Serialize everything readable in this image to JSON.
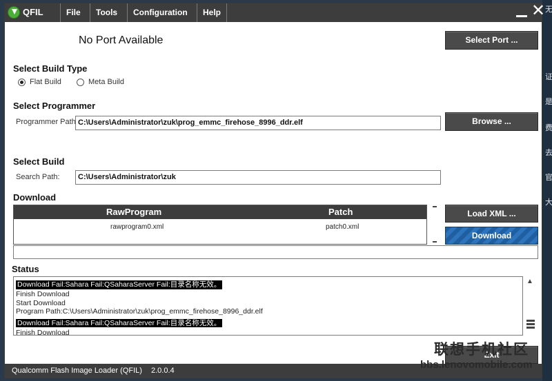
{
  "window": {
    "app_title": "QFIL",
    "menu": [
      "File",
      "Tools",
      "Configuration",
      "Help"
    ]
  },
  "port": {
    "status": "No Port Available",
    "select_button": "Select Port ..."
  },
  "build_type": {
    "heading": "Select Build Type",
    "options": [
      "Flat Build",
      "Meta Build"
    ],
    "selected": "Flat Build"
  },
  "programmer": {
    "heading": "Select Programmer",
    "path_label": "Programmer Path",
    "path_value": "C:\\Users\\Administrator\\zuk\\prog_emmc_firehose_8996_ddr.elf",
    "browse_button": "Browse ..."
  },
  "build": {
    "heading": "Select Build",
    "search_label": "Search Path:",
    "search_value": "C:\\Users\\Administrator\\zuk"
  },
  "download": {
    "heading": "Download",
    "columns": [
      "RawProgram",
      "Patch"
    ],
    "rows": [
      {
        "rawprogram": "rawprogram0.xml",
        "patch": "patch0.xml"
      }
    ],
    "load_xml_button": "Load XML ...",
    "download_button": "Download"
  },
  "status": {
    "heading": "Status",
    "log": [
      {
        "text": "Download Fail:Sahara Fail:QSaharaServer Fail:目录名称无效。",
        "selected": true
      },
      {
        "text": "Finish Download",
        "selected": false
      },
      {
        "text": "Start Download",
        "selected": false
      },
      {
        "text": "Program Path:C:\\Users\\Administrator\\zuk\\prog_emmc_firehose_8996_ddr.elf",
        "selected": false
      },
      {
        "text": "Download Fail:Sahara Fail:QSaharaServer Fail:目录名称无效。",
        "selected": true
      },
      {
        "text": "Finish Download",
        "selected": false
      }
    ]
  },
  "exit_button": "Exit",
  "footer": {
    "product": "Qualcomm Flash Image Loader (QFIL)",
    "version": "2.0.0.4"
  },
  "watermark": {
    "text": "联想手机社区",
    "url": "bbs.lenovomobile.com"
  },
  "desktop_chars": [
    "无",
    "证",
    "是",
    "费",
    "去",
    "官",
    "大"
  ],
  "colors": {
    "titlebar": "#3d3d3d",
    "button_dark": "#4a4a4a",
    "download_blue": "#1f5fa0",
    "logo_green": "#4caf3a"
  }
}
